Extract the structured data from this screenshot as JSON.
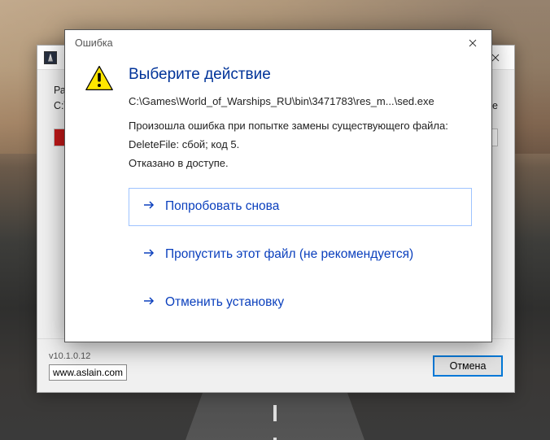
{
  "dialog": {
    "title": "Ошибка",
    "heading": "Выберите действие",
    "path": "C:\\Games\\World_of_Warships_RU\\bin\\3471783\\res_m...\\sed.exe",
    "msg1": "Произошла ошибка при попытке замены существующего файла:",
    "msg2": "DeleteFile: сбой; код 5.",
    "msg3": "Отказано в доступе.",
    "actions": {
      "retry": "Попробовать снова",
      "skip": "Пропустить этот файл (не рекомендуется)",
      "cancel": "Отменить установку"
    }
  },
  "installer": {
    "body_prefix": "Рас",
    "body_path": "C:\\",
    "body_suffix": ".exe",
    "version": "v10.1.0.12",
    "link": "www.aslain.com",
    "cancel": "Отмена"
  }
}
